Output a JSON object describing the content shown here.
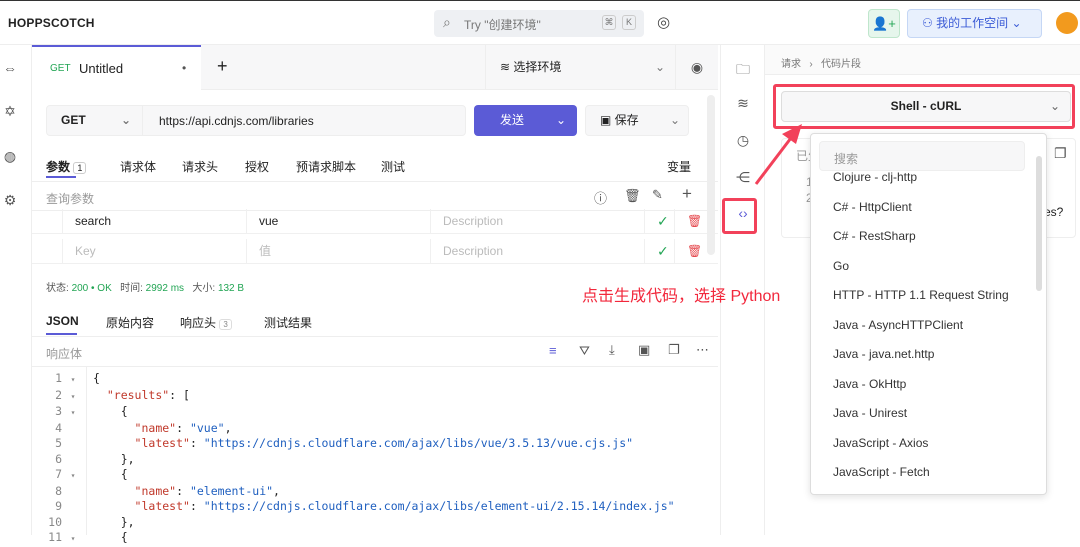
{
  "app": {
    "title": "HOPPSCOTCH",
    "search_placeholder": "Try \"创建环境\"",
    "kbd1": "⌘",
    "kbd2": "K",
    "workspace": "我的工作空间"
  },
  "tabs": [
    {
      "method": "GET",
      "label": "Untitled",
      "dirty": "•"
    }
  ],
  "new_tab": "+",
  "environment": "选择环境",
  "request": {
    "method": "GET",
    "url": "https://api.cdnjs.com/libraries",
    "send": "发送",
    "save": "保存"
  },
  "req_tabs": [
    {
      "label": "参数",
      "badge": "1"
    },
    {
      "label": "请求体"
    },
    {
      "label": "请求头"
    },
    {
      "label": "授权"
    },
    {
      "label": "预请求脚本"
    },
    {
      "label": "测试"
    }
  ],
  "variables": "变量",
  "params": {
    "title": "查询参数",
    "rows": [
      {
        "key": "search",
        "value": "vue",
        "desc": "Description"
      }
    ],
    "new_row": {
      "key": "Key",
      "value": "值",
      "desc": "Description"
    }
  },
  "status": {
    "status_label": "状态:",
    "status": "200 • OK",
    "time_label": "时间:",
    "time": "2992 ms",
    "size_label": "大小:",
    "size": "132 B"
  },
  "resp_tabs": [
    {
      "label": "JSON"
    },
    {
      "label": "原始内容"
    },
    {
      "label": "响应头",
      "badge": "3"
    },
    {
      "label": "测试结果"
    }
  ],
  "resp_body_label": "响应体",
  "code_lines": [
    {
      "n": "1",
      "fold": "▾",
      "t": "{"
    },
    {
      "n": "2",
      "fold": "▾",
      "t": "  \"results\": ["
    },
    {
      "n": "3",
      "fold": "▾",
      "t": "    {"
    },
    {
      "n": "4",
      "fold": "",
      "t": "      \"name\": \"vue\","
    },
    {
      "n": "5",
      "fold": "",
      "t": "      \"latest\": \"https://cdnjs.cloudflare.com/ajax/libs/vue/3.5.13/vue.cjs.js\""
    },
    {
      "n": "6",
      "fold": "",
      "t": "    },"
    },
    {
      "n": "7",
      "fold": "▾",
      "t": "    {"
    },
    {
      "n": "8",
      "fold": "",
      "t": "      \"name\": \"element-ui\","
    },
    {
      "n": "9",
      "fold": "",
      "t": "      \"latest\": \"https://cdnjs.cloudflare.com/ajax/libs/element-ui/2.15.14/index.js\""
    },
    {
      "n": "10",
      "fold": "",
      "t": "    },"
    },
    {
      "n": "11",
      "fold": "▾",
      "t": "    {"
    }
  ],
  "breadcrumb": [
    "请求",
    "代码片段"
  ],
  "snippet": {
    "selected": "Shell - cURL",
    "card_label": "已生",
    "line1": "1",
    "line2": "2",
    "partial": "es?"
  },
  "dropdown": {
    "search_placeholder": "搜索",
    "items": [
      "Clojure - clj-http",
      "C# - HttpClient",
      "C# - RestSharp",
      "Go",
      "HTTP - HTTP 1.1 Request String",
      "Java - AsyncHTTPClient",
      "Java - java.net.http",
      "Java - OkHttp",
      "Java - Unirest",
      "JavaScript - Axios",
      "JavaScript - Fetch"
    ]
  },
  "annotation": "点击生成代码，选择 Python",
  "colors": {
    "accent": "#5b5bd6",
    "annotation": "#f2415a",
    "success": "#22a554"
  }
}
